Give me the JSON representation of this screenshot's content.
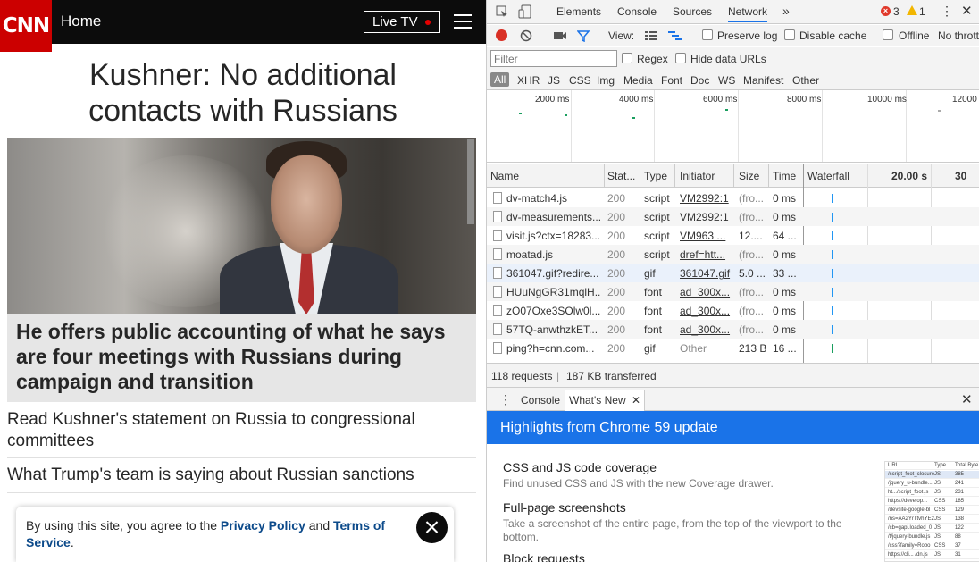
{
  "cnn": {
    "logo": "CNN",
    "home": "Home",
    "live_tv": "Live TV",
    "headline_line1": "Kushner: No additional",
    "headline_line2": "contacts with Russians",
    "hero_caption": "He offers public accounting of what he says are four meetings with Russians during campaign and transition",
    "stories": [
      "Read Kushner's statement on Russia to congressional committees",
      "What Trump's team is saying about Russian sanctions"
    ],
    "cookie": {
      "prefix": "By using this site, you agree to the ",
      "privacy": "Privacy Policy",
      "and": " and ",
      "terms": "Terms of Service",
      "suffix": "."
    }
  },
  "devtools": {
    "tabs": [
      "Elements",
      "Console",
      "Sources",
      "Network"
    ],
    "more": "»",
    "error_count": "3",
    "warning_count": "1",
    "toolbar": {
      "view": "View:",
      "preserve_log": "Preserve log",
      "disable_cache": "Disable cache",
      "offline": "Offline",
      "throttle": "No thrott"
    },
    "filter": {
      "placeholder": "Filter",
      "regex": "Regex",
      "hide_data_urls": "Hide data URLs"
    },
    "types": [
      "All",
      "XHR",
      "JS",
      "CSS",
      "Img",
      "Media",
      "Font",
      "Doc",
      "WS",
      "Manifest",
      "Other"
    ],
    "overview_labels": [
      "2000 ms",
      "4000 ms",
      "6000 ms",
      "8000 ms",
      "10000 ms",
      "12000"
    ],
    "columns": {
      "name": "Name",
      "status": "Stat...",
      "type": "Type",
      "initiator": "Initiator",
      "size": "Size",
      "time": "Time",
      "waterfall": "Waterfall",
      "t20": "20.00 s",
      "t30": "30"
    },
    "requests": [
      {
        "name": "dv-match4.js",
        "status": "200",
        "type": "script",
        "initiator": "VM2992:1",
        "size": "(fro...",
        "time": "0 ms"
      },
      {
        "name": "dv-measurements...",
        "status": "200",
        "type": "script",
        "initiator": "VM2992:1",
        "size": "(fro...",
        "time": "0 ms"
      },
      {
        "name": "visit.js?ctx=18283...",
        "status": "200",
        "type": "script",
        "initiator": "VM963 ...",
        "size": "12....",
        "time": "64 ..."
      },
      {
        "name": "moatad.js",
        "status": "200",
        "type": "script",
        "initiator": "dref=htt...",
        "size": "(fro...",
        "time": "0 ms"
      },
      {
        "name": "361047.gif?redire...",
        "status": "200",
        "type": "gif",
        "initiator": "361047.gif",
        "size": "5.0 ...",
        "time": "33 ..."
      },
      {
        "name": "HUuNgGR31mqlH...",
        "status": "200",
        "type": "font",
        "initiator": "ad_300x...",
        "size": "(fro...",
        "time": "0 ms"
      },
      {
        "name": "zO07Oxe3SOlw0l...",
        "status": "200",
        "type": "font",
        "initiator": "ad_300x...",
        "size": "(fro...",
        "time": "0 ms"
      },
      {
        "name": "57TQ-anwthzkET...",
        "status": "200",
        "type": "font",
        "initiator": "ad_300x...",
        "size": "(fro...",
        "time": "0 ms"
      },
      {
        "name": "ping?h=cnn.com...",
        "status": "200",
        "type": "gif",
        "initiator": "Other",
        "size": "213 B",
        "time": "16 ..."
      }
    ],
    "summary": {
      "requests": "118 requests",
      "sep": "|",
      "transferred": "187 KB transferred"
    },
    "drawer": {
      "console": "Console",
      "whats_new": "What's New"
    },
    "whats_new": {
      "title": "Highlights from Chrome 59 update",
      "features": [
        {
          "title": "CSS and JS code coverage",
          "desc": "Find unused CSS and JS with the new Coverage drawer."
        },
        {
          "title": "Full-page screenshots",
          "desc": "Take a screenshot of the entire page, from the top of the viewport to the bottom."
        },
        {
          "title": "Block requests",
          "desc": ""
        }
      ]
    },
    "coverage_preview": {
      "headers": [
        "URL",
        "Type",
        "Total Byte"
      ],
      "rows": [
        [
          "/script_foot_closure",
          "JS",
          "385"
        ],
        [
          "/jquery_u-bundle...",
          "JS",
          "241"
        ],
        [
          "ht.../script_foot.js",
          "JS",
          "231"
        ],
        [
          "https://develop...",
          "CSS",
          "185"
        ],
        [
          "/devsite-google-bl",
          "CSS",
          "129"
        ],
        [
          "/ns=AA2YrTtvhYE2",
          "JS",
          "138"
        ],
        [
          "/cb=gapi.loaded_0",
          "JS",
          "122"
        ],
        [
          "/t/jquery-bundle.js",
          "JS",
          "88"
        ],
        [
          "/css?family=Robo",
          "CSS",
          "37"
        ],
        [
          "https://cli... /dn.js",
          "JS",
          "31"
        ]
      ]
    }
  }
}
